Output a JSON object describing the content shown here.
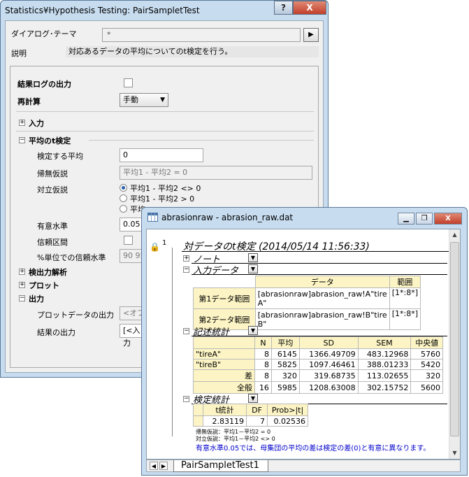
{
  "dialog": {
    "title": "Statistics¥Hypothesis Testing: PairSampletTest",
    "help_label": "?",
    "close_label": "X",
    "theme_label": "ダイアログ･テーマ",
    "theme_value": "*",
    "theme_button": "▶",
    "desc_label": "説明",
    "desc_text": "対応あるデータの平均についてのt検定を行う。",
    "result_log_label": "結果ログの出力",
    "recalc_label": "再計算",
    "recalc_value": "手動",
    "input_section": "入力",
    "ttest_section": "平均のt検定",
    "test_mean_label": "検定する平均",
    "test_mean_value": "0",
    "null_label": "帰無仮説",
    "null_value": "平均1 - 平均2 = 0",
    "alt_label": "対立仮説",
    "alt_options": [
      "平均1 - 平均2 <> 0",
      "平均1 - 平均2 > 0",
      "平均1 - 平均2 < 0"
    ],
    "alt_option3_visible": "平均",
    "sig_label": "有意水準",
    "sig_value": "0.05",
    "ci_label": "信頼区間",
    "ci_pct_label": "%単位での信頼水準",
    "ci_pct_value": "90 95",
    "power_section": "検出力解析",
    "plot_section": "プロット",
    "output_section": "出力",
    "plot_data_label": "プロットデータの出力",
    "plot_data_value": "<オブ",
    "result_out_label": "結果の出力",
    "result_out_value": "[<入力"
  },
  "report": {
    "title": "abrasionraw - abrasion_raw.dat",
    "min_label": "▁",
    "restore_label": "❐",
    "close_label": "X",
    "row_number": "1",
    "heading": "対データのt検定 (2014/05/14 11:56:33)",
    "note_section": "ノート",
    "input_section": "入力データ",
    "input_table": {
      "headers": [
        "データ",
        "範囲"
      ],
      "rows": [
        {
          "label": "第1データ範囲",
          "data_line1": "[abrasionraw]abrasion_raw!A\"tire",
          "data_line2": "A\"",
          "range": "[1*:8*]"
        },
        {
          "label": "第2データ範囲",
          "data_line1": "[abrasionraw]abrasion_raw!B\"tire",
          "data_line2": "B\"",
          "range": "[1*:8*]"
        }
      ]
    },
    "desc_section": "記述統計",
    "desc_table": {
      "headers": [
        "N",
        "平均",
        "SD",
        "SEM",
        "中央値"
      ],
      "rows": [
        {
          "label": "\"tireA\"",
          "n": "8",
          "mean": "6145",
          "sd": "1366.49709",
          "sem": "483.12968",
          "median": "5760"
        },
        {
          "label": "\"tireB\"",
          "n": "8",
          "mean": "5825",
          "sd": "1097.46461",
          "sem": "388.01233",
          "median": "5420"
        },
        {
          "label": "差",
          "n": "8",
          "mean": "320",
          "sd": "319.68735",
          "sem": "113.02655",
          "median": "320"
        },
        {
          "label": "全般",
          "n": "16",
          "mean": "5985",
          "sd": "1208.63008",
          "sem": "302.15752",
          "median": "5600"
        }
      ]
    },
    "test_section": "検定統計",
    "test_table": {
      "headers": [
        "t統計",
        "DF",
        "Prob>|t|"
      ],
      "values": [
        "2.83119",
        "7",
        "0.02536"
      ]
    },
    "null_hyp": "帰無仮説：平均1－平均2 = 0",
    "alt_hyp": "対立仮説：平均1－平均2 <> 0",
    "conclusion": "有意水準0.05では、母集団の平均の差は検定の差(0)と有意に異なります。",
    "sheet_tab": "PairSampletTest1"
  }
}
